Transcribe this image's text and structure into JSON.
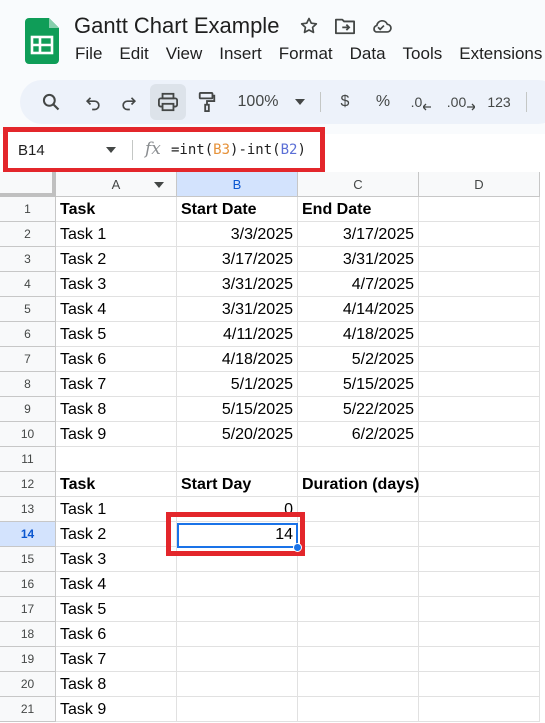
{
  "app": {
    "doc_title": "Gantt Chart Example",
    "menus": [
      "File",
      "Edit",
      "View",
      "Insert",
      "Format",
      "Data",
      "Tools",
      "Extensions"
    ]
  },
  "toolbar": {
    "zoom": "100%",
    "currency": "$",
    "percent": "%",
    "dec_decrease": ".0",
    "dec_increase": ".00",
    "number_format": "123"
  },
  "formula_bar": {
    "name_box": "B14",
    "fx": "fx",
    "formula_prefix": "=int(",
    "ref1": "B3",
    "formula_mid": ")-int(",
    "ref2": "B2",
    "formula_suffix": ")"
  },
  "sheet": {
    "columns": [
      "A",
      "B",
      "C",
      "D"
    ],
    "selected_column": "B",
    "selected_row": "14",
    "rows": [
      {
        "num": "1",
        "a": "Task",
        "b": "Start Date",
        "c": "End Date"
      },
      {
        "num": "2",
        "a": "Task 1",
        "b": "3/3/2025",
        "c": "3/17/2025"
      },
      {
        "num": "3",
        "a": "Task 2",
        "b": "3/17/2025",
        "c": "3/31/2025"
      },
      {
        "num": "4",
        "a": "Task 3",
        "b": "3/31/2025",
        "c": "4/7/2025"
      },
      {
        "num": "5",
        "a": "Task 4",
        "b": "3/31/2025",
        "c": "4/14/2025"
      },
      {
        "num": "6",
        "a": "Task 5",
        "b": "4/11/2025",
        "c": "4/18/2025"
      },
      {
        "num": "7",
        "a": "Task 6",
        "b": "4/18/2025",
        "c": "5/2/2025"
      },
      {
        "num": "8",
        "a": "Task 7",
        "b": "5/1/2025",
        "c": "5/15/2025"
      },
      {
        "num": "9",
        "a": "Task 8",
        "b": "5/15/2025",
        "c": "5/22/2025"
      },
      {
        "num": "10",
        "a": "Task 9",
        "b": "5/20/2025",
        "c": "6/2/2025"
      },
      {
        "num": "11",
        "a": "",
        "b": "",
        "c": ""
      },
      {
        "num": "12",
        "a": "Task",
        "b": "Start Day",
        "c": "Duration (days)"
      },
      {
        "num": "13",
        "a": "Task 1",
        "b": "0",
        "c": ""
      },
      {
        "num": "14",
        "a": "Task 2",
        "b": "14",
        "c": ""
      },
      {
        "num": "15",
        "a": "Task 3",
        "b": "",
        "c": ""
      },
      {
        "num": "16",
        "a": "Task 4",
        "b": "",
        "c": ""
      },
      {
        "num": "17",
        "a": "Task 5",
        "b": "",
        "c": ""
      },
      {
        "num": "18",
        "a": "Task 6",
        "b": "",
        "c": ""
      },
      {
        "num": "19",
        "a": "Task 7",
        "b": "",
        "c": ""
      },
      {
        "num": "20",
        "a": "Task 8",
        "b": "",
        "c": ""
      },
      {
        "num": "21",
        "a": "Task 9",
        "b": "",
        "c": ""
      }
    ]
  },
  "colors": {
    "highlight_box": "#e3262b",
    "active_cell": "#1a73e8",
    "logo_green": "#0f9d58"
  }
}
